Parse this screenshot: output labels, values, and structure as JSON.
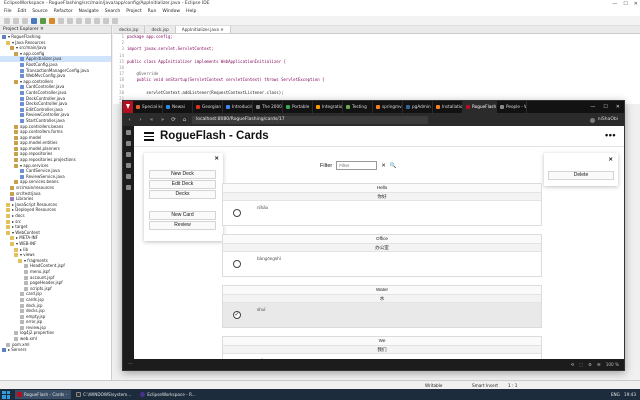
{
  "eclipse": {
    "title": "EclipseWorkspace - RogueFlashing/src/main/java/app/config/AppInitializer.java - Eclipse IDE",
    "win_controls": [
      "—",
      "☐",
      "✕"
    ],
    "menu": [
      "File",
      "Edit",
      "Source",
      "Refactor",
      "Navigate",
      "Search",
      "Project",
      "Run",
      "Window",
      "Help"
    ],
    "explorer_title": "Project Explorer ✕",
    "tree": [
      {
        "label": "▾ RogueFlashing",
        "icon": "proj",
        "indent": 1
      },
      {
        "label": "▾ Java Resources",
        "icon": "folder",
        "indent": 3
      },
      {
        "label": "▾ src/main/java",
        "icon": "pkg",
        "indent": 5
      },
      {
        "label": "▾ app.config",
        "icon": "pkg",
        "indent": 7
      },
      {
        "label": "AppInitializer.java",
        "icon": "java",
        "indent": 10
      },
      {
        "label": "RootConfig.java",
        "icon": "java",
        "indent": 10
      },
      {
        "label": "TransactionManagerConfig.java",
        "icon": "java",
        "indent": 10
      },
      {
        "label": "WebMvcConfig.java",
        "icon": "java",
        "indent": 10
      },
      {
        "label": "▾ app.controllers",
        "icon": "pkg",
        "indent": 7
      },
      {
        "label": "CardController.java",
        "icon": "java",
        "indent": 10
      },
      {
        "label": "CardsController.java",
        "icon": "java",
        "indent": 10
      },
      {
        "label": "DeckController.java",
        "icon": "java",
        "indent": 10
      },
      {
        "label": "DecksController.java",
        "icon": "java",
        "indent": 10
      },
      {
        "label": "EditController.java",
        "icon": "java",
        "indent": 10
      },
      {
        "label": "ReviewController.java",
        "icon": "java",
        "indent": 10
      },
      {
        "label": "StartController.java",
        "icon": "java",
        "indent": 10
      },
      {
        "label": "app.controllers.beans",
        "icon": "pkg",
        "indent": 7
      },
      {
        "label": "app.controllers.forms",
        "icon": "pkg",
        "indent": 7
      },
      {
        "label": "app.model",
        "icon": "pkg",
        "indent": 7
      },
      {
        "label": "app.model.entities",
        "icon": "pkg",
        "indent": 7
      },
      {
        "label": "app.model.planners",
        "icon": "pkg",
        "indent": 7
      },
      {
        "label": "app.repositories",
        "icon": "pkg",
        "indent": 7
      },
      {
        "label": "app.repositories.projections",
        "icon": "pkg",
        "indent": 7
      },
      {
        "label": "▾ app.services",
        "icon": "pkg",
        "indent": 7
      },
      {
        "label": "CardService.java",
        "icon": "java",
        "indent": 10
      },
      {
        "label": "ReviewService.java",
        "icon": "java",
        "indent": 10
      },
      {
        "label": "app.services.beans",
        "icon": "pkg",
        "indent": 7
      },
      {
        "label": "src/main/resources",
        "icon": "pkg",
        "indent": 5
      },
      {
        "label": "src/test/java",
        "icon": "pkg",
        "indent": 5
      },
      {
        "label": "Libraries",
        "icon": "lib",
        "indent": 5
      },
      {
        "label": "▸ JavaScript Resources",
        "icon": "folder",
        "indent": 3
      },
      {
        "label": "▸ Deployed Resources",
        "icon": "folder",
        "indent": 3
      },
      {
        "label": "▸ docs",
        "icon": "folder",
        "indent": 3
      },
      {
        "label": "▸ src",
        "icon": "folder",
        "indent": 3
      },
      {
        "label": "▸ target",
        "icon": "folder",
        "indent": 3
      },
      {
        "label": "▾ WebContent",
        "icon": "folder",
        "indent": 3
      },
      {
        "label": "▸ META-INF",
        "icon": "folder",
        "indent": 5
      },
      {
        "label": "▾ WEB-INF",
        "icon": "folder",
        "indent": 5
      },
      {
        "label": "▸ lib",
        "icon": "folder",
        "indent": 7
      },
      {
        "label": "▾ views",
        "icon": "folder",
        "indent": 7
      },
      {
        "label": "▾ fragments",
        "icon": "folder",
        "indent": 9
      },
      {
        "label": "HeadContent.jspf",
        "icon": "file",
        "indent": 12
      },
      {
        "label": "menu.jspf",
        "icon": "file",
        "indent": 12
      },
      {
        "label": "account.jspf",
        "icon": "file",
        "indent": 12
      },
      {
        "label": "pageHeader.jspf",
        "icon": "file",
        "indent": 12
      },
      {
        "label": "scripts.jspf",
        "icon": "file",
        "indent": 12
      },
      {
        "label": "card.jsp",
        "icon": "file",
        "indent": 10
      },
      {
        "label": "cards.jsp",
        "icon": "file",
        "indent": 10
      },
      {
        "label": "deck.jsp",
        "icon": "file",
        "indent": 10
      },
      {
        "label": "decks.jsp",
        "icon": "file",
        "indent": 10
      },
      {
        "label": "empty.jsp",
        "icon": "file",
        "indent": 10
      },
      {
        "label": "error.jsp",
        "icon": "file",
        "indent": 10
      },
      {
        "label": "review.jsp",
        "icon": "file",
        "indent": 10
      },
      {
        "label": "log4j2.properties",
        "icon": "file",
        "indent": 7
      },
      {
        "label": "web.xml",
        "icon": "file",
        "indent": 7
      },
      {
        "label": "pom.xml",
        "icon": "file",
        "indent": 3
      },
      {
        "label": "▸ Servers",
        "icon": "proj",
        "indent": 1
      }
    ],
    "editor_tabs": [
      "decks.jsp",
      "deck.jsp",
      "AppInitializer.java ✕"
    ],
    "code": [
      {
        "n": "1",
        "t": "package app.config;"
      },
      {
        "n": "2",
        "t": ""
      },
      {
        "n": "3",
        "t": "import javax.servlet.ServletContext;"
      },
      {
        "n": "14",
        "t": ""
      },
      {
        "n": "15",
        "t": "public class AppInitializer implements WebApplicationInitializer {"
      },
      {
        "n": "16",
        "t": ""
      },
      {
        "n": "17",
        "t": "    @Override"
      },
      {
        "n": "18",
        "t": "    public void onStartup(ServletContext servletContext) throws ServletException {"
      },
      {
        "n": "19",
        "t": ""
      },
      {
        "n": "20",
        "t": "        servletContext.addListener(RequestContextListener.class);"
      },
      {
        "n": "21",
        "t": ""
      },
      {
        "n": "22",
        "t": "        // https://stackoverflow.com/questions/28877982/spring-java-config-with-multiple-dispatchers"
      }
    ],
    "status": {
      "writable": "Writable",
      "insert": "Smart Insert",
      "position": "1 : 1"
    }
  },
  "taskbar": {
    "tasks": [
      {
        "label": "RogueFlash - Cards -",
        "color": "#b5101f",
        "active": true
      },
      {
        "label": "C:\\WINDOWS\\system...",
        "color": "#333333",
        "active": false
      },
      {
        "label": "EclipseWorkspace - R...",
        "color": "#4b2f8a",
        "active": false
      }
    ],
    "tray": [
      "ENG",
      "19:43"
    ]
  },
  "browser": {
    "tabs": [
      {
        "label": "Special key",
        "color": "#e05a2a"
      },
      {
        "label": "Newai",
        "color": "#2a8ae0"
      },
      {
        "label": "Georgian o",
        "color": "#d93025"
      },
      {
        "label": "Introducin",
        "color": "#4285f4"
      },
      {
        "label": "The 2000's",
        "color": "#888888"
      },
      {
        "label": "Portable",
        "color": "#34a853"
      },
      {
        "label": "Integratio",
        "color": "#ff9900"
      },
      {
        "label": "Testing",
        "color": "#6aa84f"
      },
      {
        "label": "springmvc",
        "color": "#f48024"
      },
      {
        "label": "pgAdmin 4",
        "color": "#336791"
      },
      {
        "label": "Installatio",
        "color": "#f48024"
      },
      {
        "label": "RogueFlash",
        "color": "#b5101f",
        "active": true
      },
      {
        "label": "People - Wi",
        "color": "#888888"
      }
    ],
    "url": "localhost:8080/RogueFlashing/cards/17",
    "user": "niShaObi",
    "bottom_left": "⋯",
    "bottom_right": [
      "⟲",
      "⬚",
      "⚙",
      "☰",
      "100 %"
    ]
  },
  "app": {
    "title": "RogueFlash - Cards",
    "more": "•••",
    "left_panel": {
      "close": "✕",
      "buttons": [
        "New Deck",
        "Edit Deck",
        "Decks",
        "New Card",
        "Review"
      ]
    },
    "filter": {
      "label": "Filter",
      "placeholder": "Filter",
      "clear": "✕",
      "search": "🔍"
    },
    "right_panel": {
      "close": "✕",
      "delete": "Delete"
    },
    "cards": [
      {
        "front": "Hello",
        "back": "你好",
        "pinyin": "nǐhǎo",
        "selected": false
      },
      {
        "front": "Office",
        "back": "办公室",
        "pinyin": "bàngōngshì",
        "selected": false
      },
      {
        "front": "Water",
        "back": "水",
        "pinyin": "shuǐ",
        "selected": true
      },
      {
        "front": "We",
        "back": "我们",
        "pinyin": "wǒmen",
        "selected": false
      }
    ]
  }
}
